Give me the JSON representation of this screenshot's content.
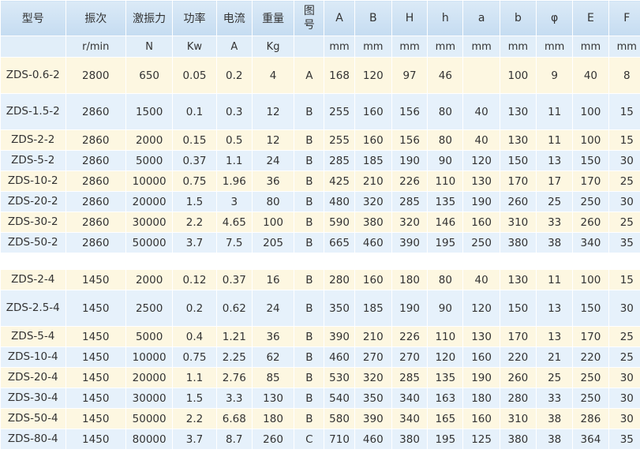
{
  "headers": [
    "型号",
    "振次",
    "激振力",
    "功率",
    "电流",
    "重量",
    "图号",
    "A",
    "B",
    "H",
    "h",
    "a",
    "b",
    "φ",
    "E",
    "F"
  ],
  "units": [
    "",
    "r/min",
    "N",
    "Kw",
    "A",
    "Kg",
    "",
    "mm",
    "mm",
    "mm",
    "mm",
    "mm",
    "mm",
    "mm",
    "mm",
    "mm"
  ],
  "group1": [
    [
      "ZDS-0.6-2",
      "2800",
      "650",
      "0.05",
      "0.2",
      "4",
      "A",
      "168",
      "120",
      "97",
      "46",
      "",
      "100",
      "9",
      "40",
      "8"
    ],
    [
      "ZDS-1.5-2",
      "2860",
      "1500",
      "0.1",
      "0.3",
      "12",
      "B",
      "255",
      "160",
      "156",
      "80",
      "40",
      "130",
      "11",
      "100",
      "15"
    ],
    [
      "ZDS-2-2",
      "2860",
      "2000",
      "0.15",
      "0.5",
      "12",
      "B",
      "255",
      "160",
      "156",
      "80",
      "40",
      "130",
      "11",
      "100",
      "15"
    ],
    [
      "ZDS-5-2",
      "2860",
      "5000",
      "0.37",
      "1.1",
      "24",
      "B",
      "285",
      "185",
      "190",
      "90",
      "120",
      "150",
      "13",
      "150",
      "30"
    ],
    [
      "ZDS-10-2",
      "2860",
      "10000",
      "0.75",
      "1.96",
      "36",
      "B",
      "425",
      "210",
      "226",
      "110",
      "130",
      "170",
      "17",
      "170",
      "25"
    ],
    [
      "ZDS-20-2",
      "2860",
      "20000",
      "1.5",
      "3",
      "80",
      "B",
      "480",
      "320",
      "285",
      "135",
      "190",
      "260",
      "25",
      "250",
      "30"
    ],
    [
      "ZDS-30-2",
      "2860",
      "30000",
      "2.2",
      "4.65",
      "100",
      "B",
      "590",
      "380",
      "320",
      "146",
      "160",
      "310",
      "33",
      "260",
      "25"
    ],
    [
      "ZDS-50-2",
      "2860",
      "50000",
      "3.7",
      "7.5",
      "205",
      "B",
      "665",
      "460",
      "390",
      "195",
      "250",
      "380",
      "38",
      "340",
      "35"
    ]
  ],
  "group2": [
    [
      "ZDS-2-4",
      "1450",
      "2000",
      "0.12",
      "0.37",
      "16",
      "B",
      "280",
      "160",
      "180",
      "80",
      "40",
      "130",
      "11",
      "100",
      "15"
    ],
    [
      "ZDS-2.5-4",
      "1450",
      "2500",
      "0.2",
      "0.62",
      "24",
      "B",
      "350",
      "185",
      "190",
      "90",
      "120",
      "150",
      "13",
      "150",
      "30"
    ],
    [
      "ZDS-5-4",
      "1450",
      "5000",
      "0.4",
      "1.21",
      "36",
      "B",
      "390",
      "210",
      "226",
      "110",
      "130",
      "170",
      "13",
      "170",
      "25"
    ],
    [
      "ZDS-10-4",
      "1450",
      "10000",
      "0.75",
      "2.25",
      "62",
      "B",
      "460",
      "270",
      "270",
      "120",
      "160",
      "220",
      "21",
      "220",
      "25"
    ],
    [
      "ZDS-20-4",
      "1450",
      "20000",
      "1.1",
      "2.76",
      "85",
      "B",
      "530",
      "320",
      "285",
      "135",
      "190",
      "260",
      "25",
      "250",
      "30"
    ],
    [
      "ZDS-30-4",
      "1450",
      "30000",
      "1.5",
      "3.3",
      "130",
      "B",
      "540",
      "350",
      "340",
      "163",
      "180",
      "280",
      "33",
      "250",
      "30"
    ],
    [
      "ZDS-50-4",
      "1450",
      "50000",
      "2.2",
      "6.68",
      "180",
      "B",
      "580",
      "390",
      "340",
      "165",
      "160",
      "310",
      "38",
      "286",
      "30"
    ],
    [
      "ZDS-80-4",
      "1450",
      "80000",
      "3.7",
      "8.7",
      "260",
      "C",
      "710",
      "460",
      "380",
      "195",
      "125",
      "380",
      "38",
      "364",
      "35"
    ]
  ]
}
